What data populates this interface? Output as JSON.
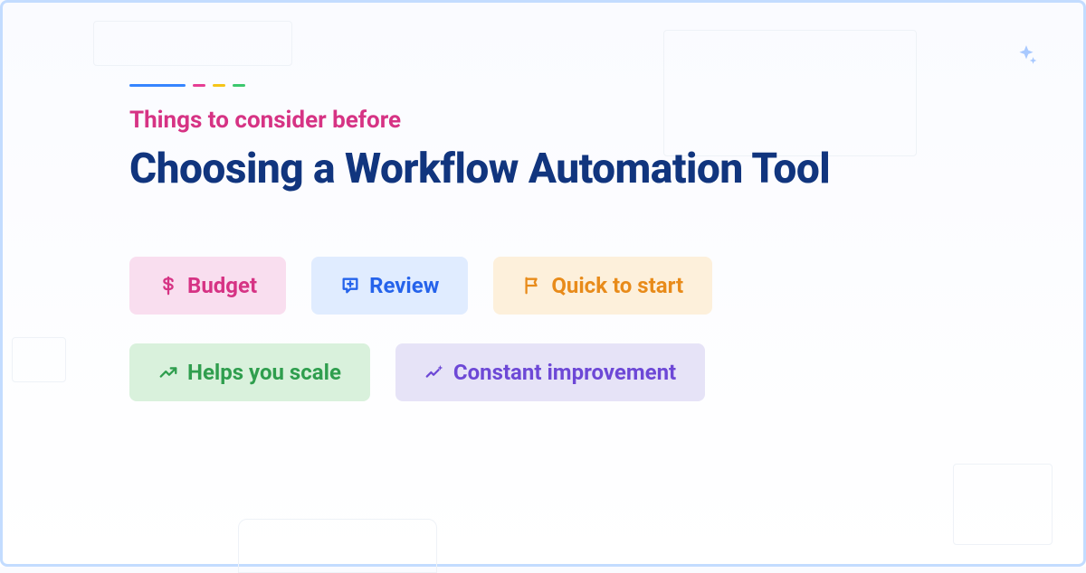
{
  "eyebrow": "Things to consider before",
  "headline": "Choosing a Workflow Automation Tool",
  "chips": {
    "budget": {
      "label": "Budget"
    },
    "review": {
      "label": "Review"
    },
    "quick": {
      "label": "Quick to start"
    },
    "scale": {
      "label": "Helps you scale"
    },
    "improve": {
      "label": "Constant improvement"
    }
  },
  "accentColors": {
    "blue": "#3685ff",
    "pink": "#e63e94",
    "yellow": "#f5c518",
    "green": "#3cc86e"
  }
}
